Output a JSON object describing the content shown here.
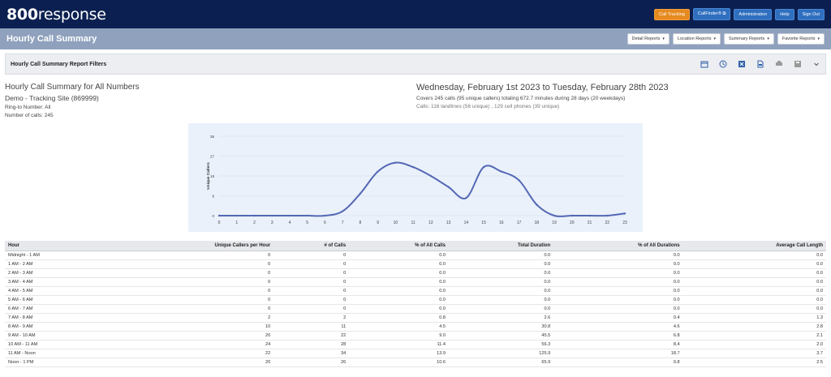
{
  "brand": {
    "num": "800",
    "word": "response"
  },
  "topnav": [
    {
      "label": "Call Tracking",
      "style": "orange"
    },
    {
      "label": "CallFinder® ⧉",
      "style": "blue"
    },
    {
      "label": "Administration",
      "style": "blue"
    },
    {
      "label": "Help",
      "style": "blue"
    },
    {
      "label": "Sign Out",
      "style": "blue"
    }
  ],
  "page_title": "Hourly Call Summary",
  "report_menus": [
    "Detail Reports",
    "Location Reports",
    "Summary Reports",
    "Favorite Reports"
  ],
  "filters_title": "Hourly Call Summary Report Filters",
  "filter_icons": [
    "calendar-icon",
    "clock-icon",
    "excel-icon",
    "pdf-icon",
    "printer-icon",
    "save-icon",
    "chevron-down-icon"
  ],
  "summary": {
    "title": "Hourly Call Summary for All Numbers",
    "site": "Demo - Tracking Site (869999)",
    "ring_to": "Ring-to Number: All",
    "num_calls": "Number of calls: 245",
    "date_range": "Wednesday, February 1st 2023 to Tuesday, February 28th 2023",
    "covers": "Covers 245 calls (95 unique callers) totaling 672.7 minutes during 28 days (20 weekdays)",
    "calls_breakdown": "Calls: 116 landlines (56 unique) , 129 cell phones (39 unique)"
  },
  "chart_data": {
    "type": "line",
    "ylabel": "Unique Callers",
    "xlabel": "",
    "x": [
      0,
      1,
      2,
      3,
      4,
      5,
      6,
      7,
      8,
      9,
      10,
      11,
      12,
      13,
      14,
      15,
      16,
      17,
      18,
      19,
      20,
      21,
      22,
      23
    ],
    "values": [
      0,
      0,
      0,
      0,
      0,
      0,
      0,
      2,
      10,
      20,
      24,
      22,
      18,
      13,
      8,
      22,
      20,
      16,
      5,
      0,
      0,
      0,
      0,
      1
    ],
    "yticks": [
      0,
      9,
      18,
      27,
      36
    ],
    "ylim": [
      0,
      36
    ],
    "grid": true,
    "color": "#5468b4"
  },
  "table": {
    "columns": [
      "Hour",
      "Unique Callers per Hour",
      "# of Calls",
      "% of All Calls",
      "Total Duration",
      "% of All Durations",
      "Average Call Length"
    ],
    "rows": [
      [
        "Midnight - 1 AM",
        "0",
        "0",
        "0.0",
        "0.0",
        "0.0",
        "0.0"
      ],
      [
        "1 AM - 2 AM",
        "0",
        "0",
        "0.0",
        "0.0",
        "0.0",
        "0.0"
      ],
      [
        "2 AM - 3 AM",
        "0",
        "0",
        "0.0",
        "0.0",
        "0.0",
        "0.0"
      ],
      [
        "3 AM - 4 AM",
        "0",
        "0",
        "0.0",
        "0.0",
        "0.0",
        "0.0"
      ],
      [
        "4 AM - 5 AM",
        "0",
        "0",
        "0.0",
        "0.0",
        "0.0",
        "0.0"
      ],
      [
        "5 AM - 6 AM",
        "0",
        "0",
        "0.0",
        "0.0",
        "0.0",
        "0.0"
      ],
      [
        "6 AM - 7 AM",
        "0",
        "0",
        "0.0",
        "0.0",
        "0.0",
        "0.0"
      ],
      [
        "7 AM - 8 AM",
        "2",
        "2",
        "0.8",
        "2.6",
        "0.4",
        "1.3"
      ],
      [
        "8 AM - 9 AM",
        "10",
        "11",
        "4.5",
        "30.8",
        "4.6",
        "2.8"
      ],
      [
        "9 AM - 10 AM",
        "20",
        "22",
        "9.0",
        "45.5",
        "6.8",
        "2.1"
      ],
      [
        "10 AM - 11 AM",
        "24",
        "28",
        "11.4",
        "56.3",
        "8.4",
        "2.0"
      ],
      [
        "11 AM - Noon",
        "22",
        "34",
        "13.9",
        "125.9",
        "18.7",
        "3.7"
      ],
      [
        "Noon - 1 PM",
        "20",
        "26",
        "10.6",
        "65.9",
        "9.8",
        "2.5"
      ]
    ]
  }
}
